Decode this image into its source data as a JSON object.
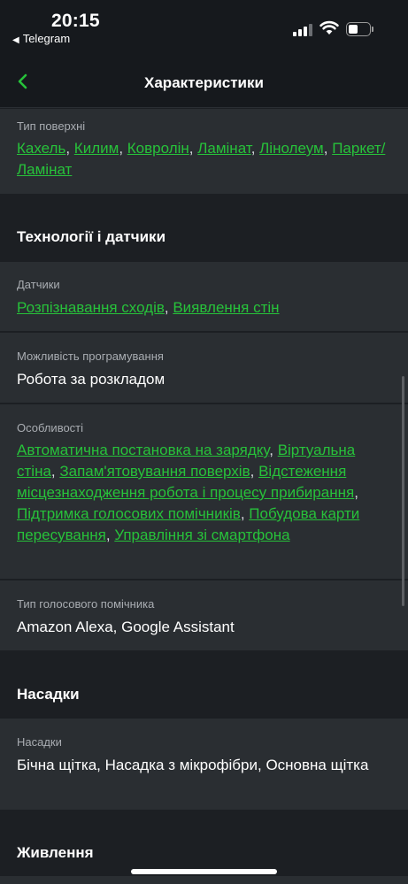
{
  "status_bar": {
    "time": "20:15",
    "back_app_arrow": "◀",
    "back_app": "Telegram",
    "icons": [
      "cellular-signal-icon",
      "wifi-icon",
      "battery-icon"
    ]
  },
  "nav": {
    "title": "Характеристики",
    "back_icon": "chevron-left-icon",
    "accent_color": "#27c23a"
  },
  "sections": {
    "surface": {
      "label": "Тип поверхні",
      "links": [
        "Кахель",
        "Килим",
        "Ковролін",
        "Ламінат",
        "Лінолеум",
        "Паркет/Ламінат"
      ]
    },
    "tech_header": "Технології і датчики",
    "sensors": {
      "label": "Датчики",
      "links": [
        "Розпізнавання сходів",
        "Виявлення стін"
      ]
    },
    "programming": {
      "label": "Можливість програмування",
      "value": "Робота за розкладом"
    },
    "features": {
      "label": "Особливості",
      "links": [
        "Автоматична постановка на зарядку",
        "Віртуальна стіна",
        "Запам'ятовування поверхів",
        "Відстеження місцезнаходження робота і процесу прибирання",
        "Підтримка голосових помічників",
        "Побудова карти пересування",
        "Управління зі смартфона"
      ]
    },
    "voice": {
      "label": "Тип голосового помічника",
      "value": "Amazon Alexa, Google Assistant"
    },
    "attachments_header": "Насадки",
    "attachments": {
      "label": "Насадки",
      "value": "Бічна щітка, Насадка з мікрофібри, Основна щітка"
    },
    "power_header": "Живлення"
  }
}
